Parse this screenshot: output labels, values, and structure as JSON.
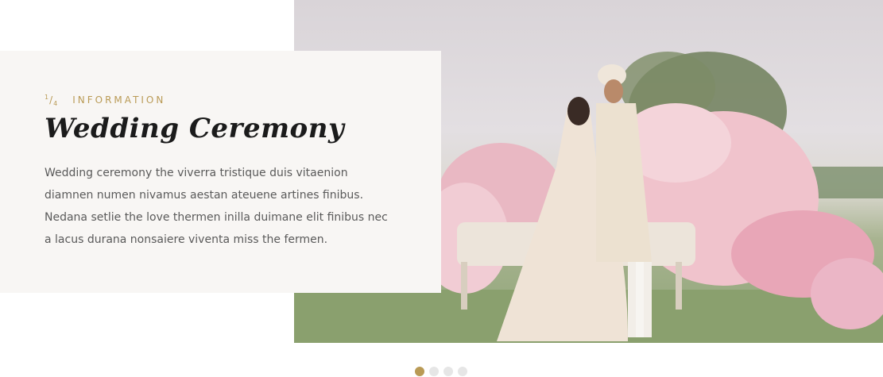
{
  "slide": {
    "index": "1",
    "total": "4",
    "kicker": "INFORMATION",
    "title": "Wedding Ceremony",
    "description": "Wedding ceremony the viverra tristique duis vitaenion diamnen numen nivamus aestan ateuene artines finibus.  Nedana setlie the love thermen inilla duimane elit finibus nec a lacus durana nonsaiere viventa miss the fermen."
  },
  "pagination": {
    "count": 4,
    "active": 1
  },
  "colors": {
    "accent": "#b99a55",
    "card_bg": "#f8f6f4",
    "title": "#1b1b1b",
    "body": "#5a5a5a",
    "dot_inactive": "#e6e6e6"
  }
}
